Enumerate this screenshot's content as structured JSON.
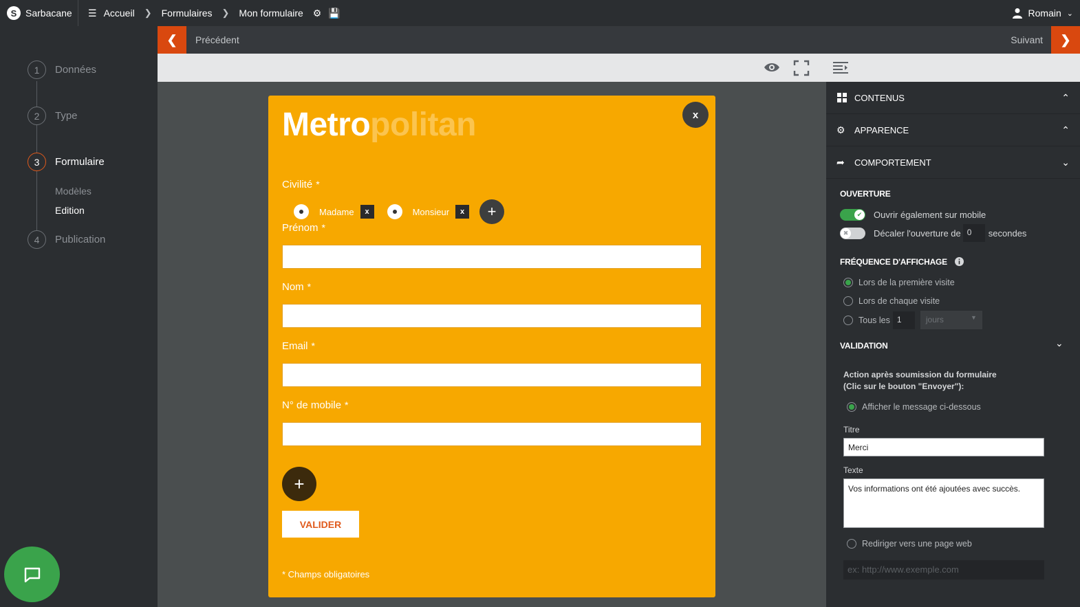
{
  "app": {
    "brand": "Sarbacane",
    "logo_letter": "S"
  },
  "breadcrumb": [
    "Accueil",
    "Formulaires",
    "Mon formulaire"
  ],
  "user": {
    "name": "Romain"
  },
  "nav": {
    "prev": "Précédent",
    "next": "Suivant"
  },
  "steps": [
    {
      "num": "1",
      "label": "Données"
    },
    {
      "num": "2",
      "label": "Type"
    },
    {
      "num": "3",
      "label": "Formulaire"
    },
    {
      "num": "4",
      "label": "Publication"
    }
  ],
  "substeps": [
    "Modèles",
    "Edition"
  ],
  "form": {
    "title_bold": "Metro",
    "title_light": "politan",
    "close": "x",
    "civility_label": "Civilité",
    "req": "*",
    "options": [
      {
        "label": "Madame",
        "remove": "x"
      },
      {
        "label": "Monsieur",
        "remove": "x"
      }
    ],
    "fields": [
      "Prénom",
      "Nom",
      "Email",
      "N° de mobile"
    ],
    "submit": "VALIDER",
    "required_note": "* Champs obligatoires"
  },
  "panel": {
    "sections": [
      {
        "label": "CONTENUS",
        "icon": "grid-icon",
        "state": "collapse"
      },
      {
        "label": "APPARENCE",
        "icon": "gear-icon",
        "state": "collapse"
      },
      {
        "label": "COMPORTEMENT",
        "icon": "share-icon",
        "state": "expand"
      }
    ],
    "ouverture": {
      "title": "OUVERTURE",
      "mobile": "Ouvrir également sur mobile",
      "delay_before": "Décaler l'ouverture de",
      "delay_value": "0",
      "delay_after": "secondes"
    },
    "frequence": {
      "title": "FRÉQUENCE D'AFFICHAGE",
      "first": "Lors de la première visite",
      "each": "Lors de chaque visite",
      "every_prefix": "Tous les",
      "every_value": "1",
      "every_unit": "jours"
    },
    "validation": {
      "title": "VALIDATION",
      "action_line1": "Action après soumission du formulaire",
      "action_line2": "(Clic sur le bouton \"Envoyer\"):",
      "show_message": "Afficher le message ci-dessous",
      "titre_label": "Titre",
      "titre_value": "Merci",
      "texte_label": "Texte",
      "texte_value": "Vos informations ont été ajoutées avec succès.",
      "redirect": "Rediriger vers une page web",
      "url_placeholder": "ex: http://www.exemple.com"
    }
  },
  "colors": {
    "accent": "#d9480f",
    "form_bg": "#f7a800",
    "toggle_on": "#3aa34b"
  }
}
